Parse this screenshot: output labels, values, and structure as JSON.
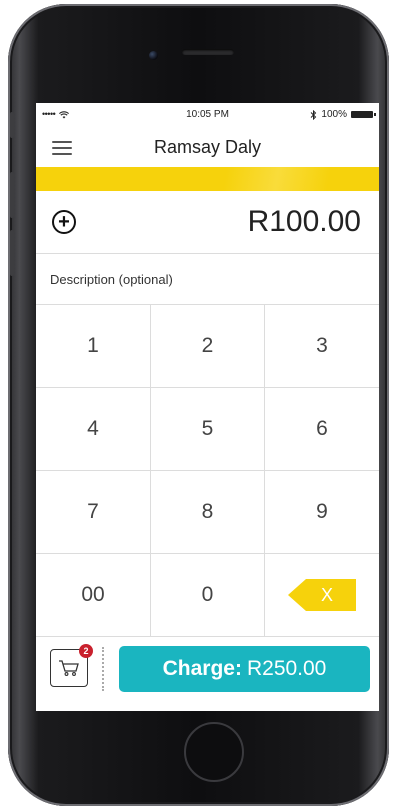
{
  "status": {
    "signal": "•••••",
    "time": "10:05 PM",
    "battery_text": "100%"
  },
  "nav": {
    "title": "Ramsay Daly"
  },
  "amount": {
    "value": "R100.00"
  },
  "description": {
    "placeholder": "Description (optional)"
  },
  "keypad": {
    "keys": [
      "1",
      "2",
      "3",
      "4",
      "5",
      "6",
      "7",
      "8",
      "9",
      "00",
      "0"
    ],
    "backspace_label": "X"
  },
  "cart": {
    "count": "2"
  },
  "charge": {
    "label": "Charge:",
    "amount": "R250.00"
  },
  "colors": {
    "accent_yellow": "#f6d20c",
    "charge_teal": "#1ab5c0",
    "badge_red": "#c9212d"
  },
  "icons": [
    "menu-icon",
    "add-icon",
    "wifi-icon",
    "bluetooth-icon",
    "battery-icon",
    "cart-icon",
    "backspace-icon"
  ]
}
